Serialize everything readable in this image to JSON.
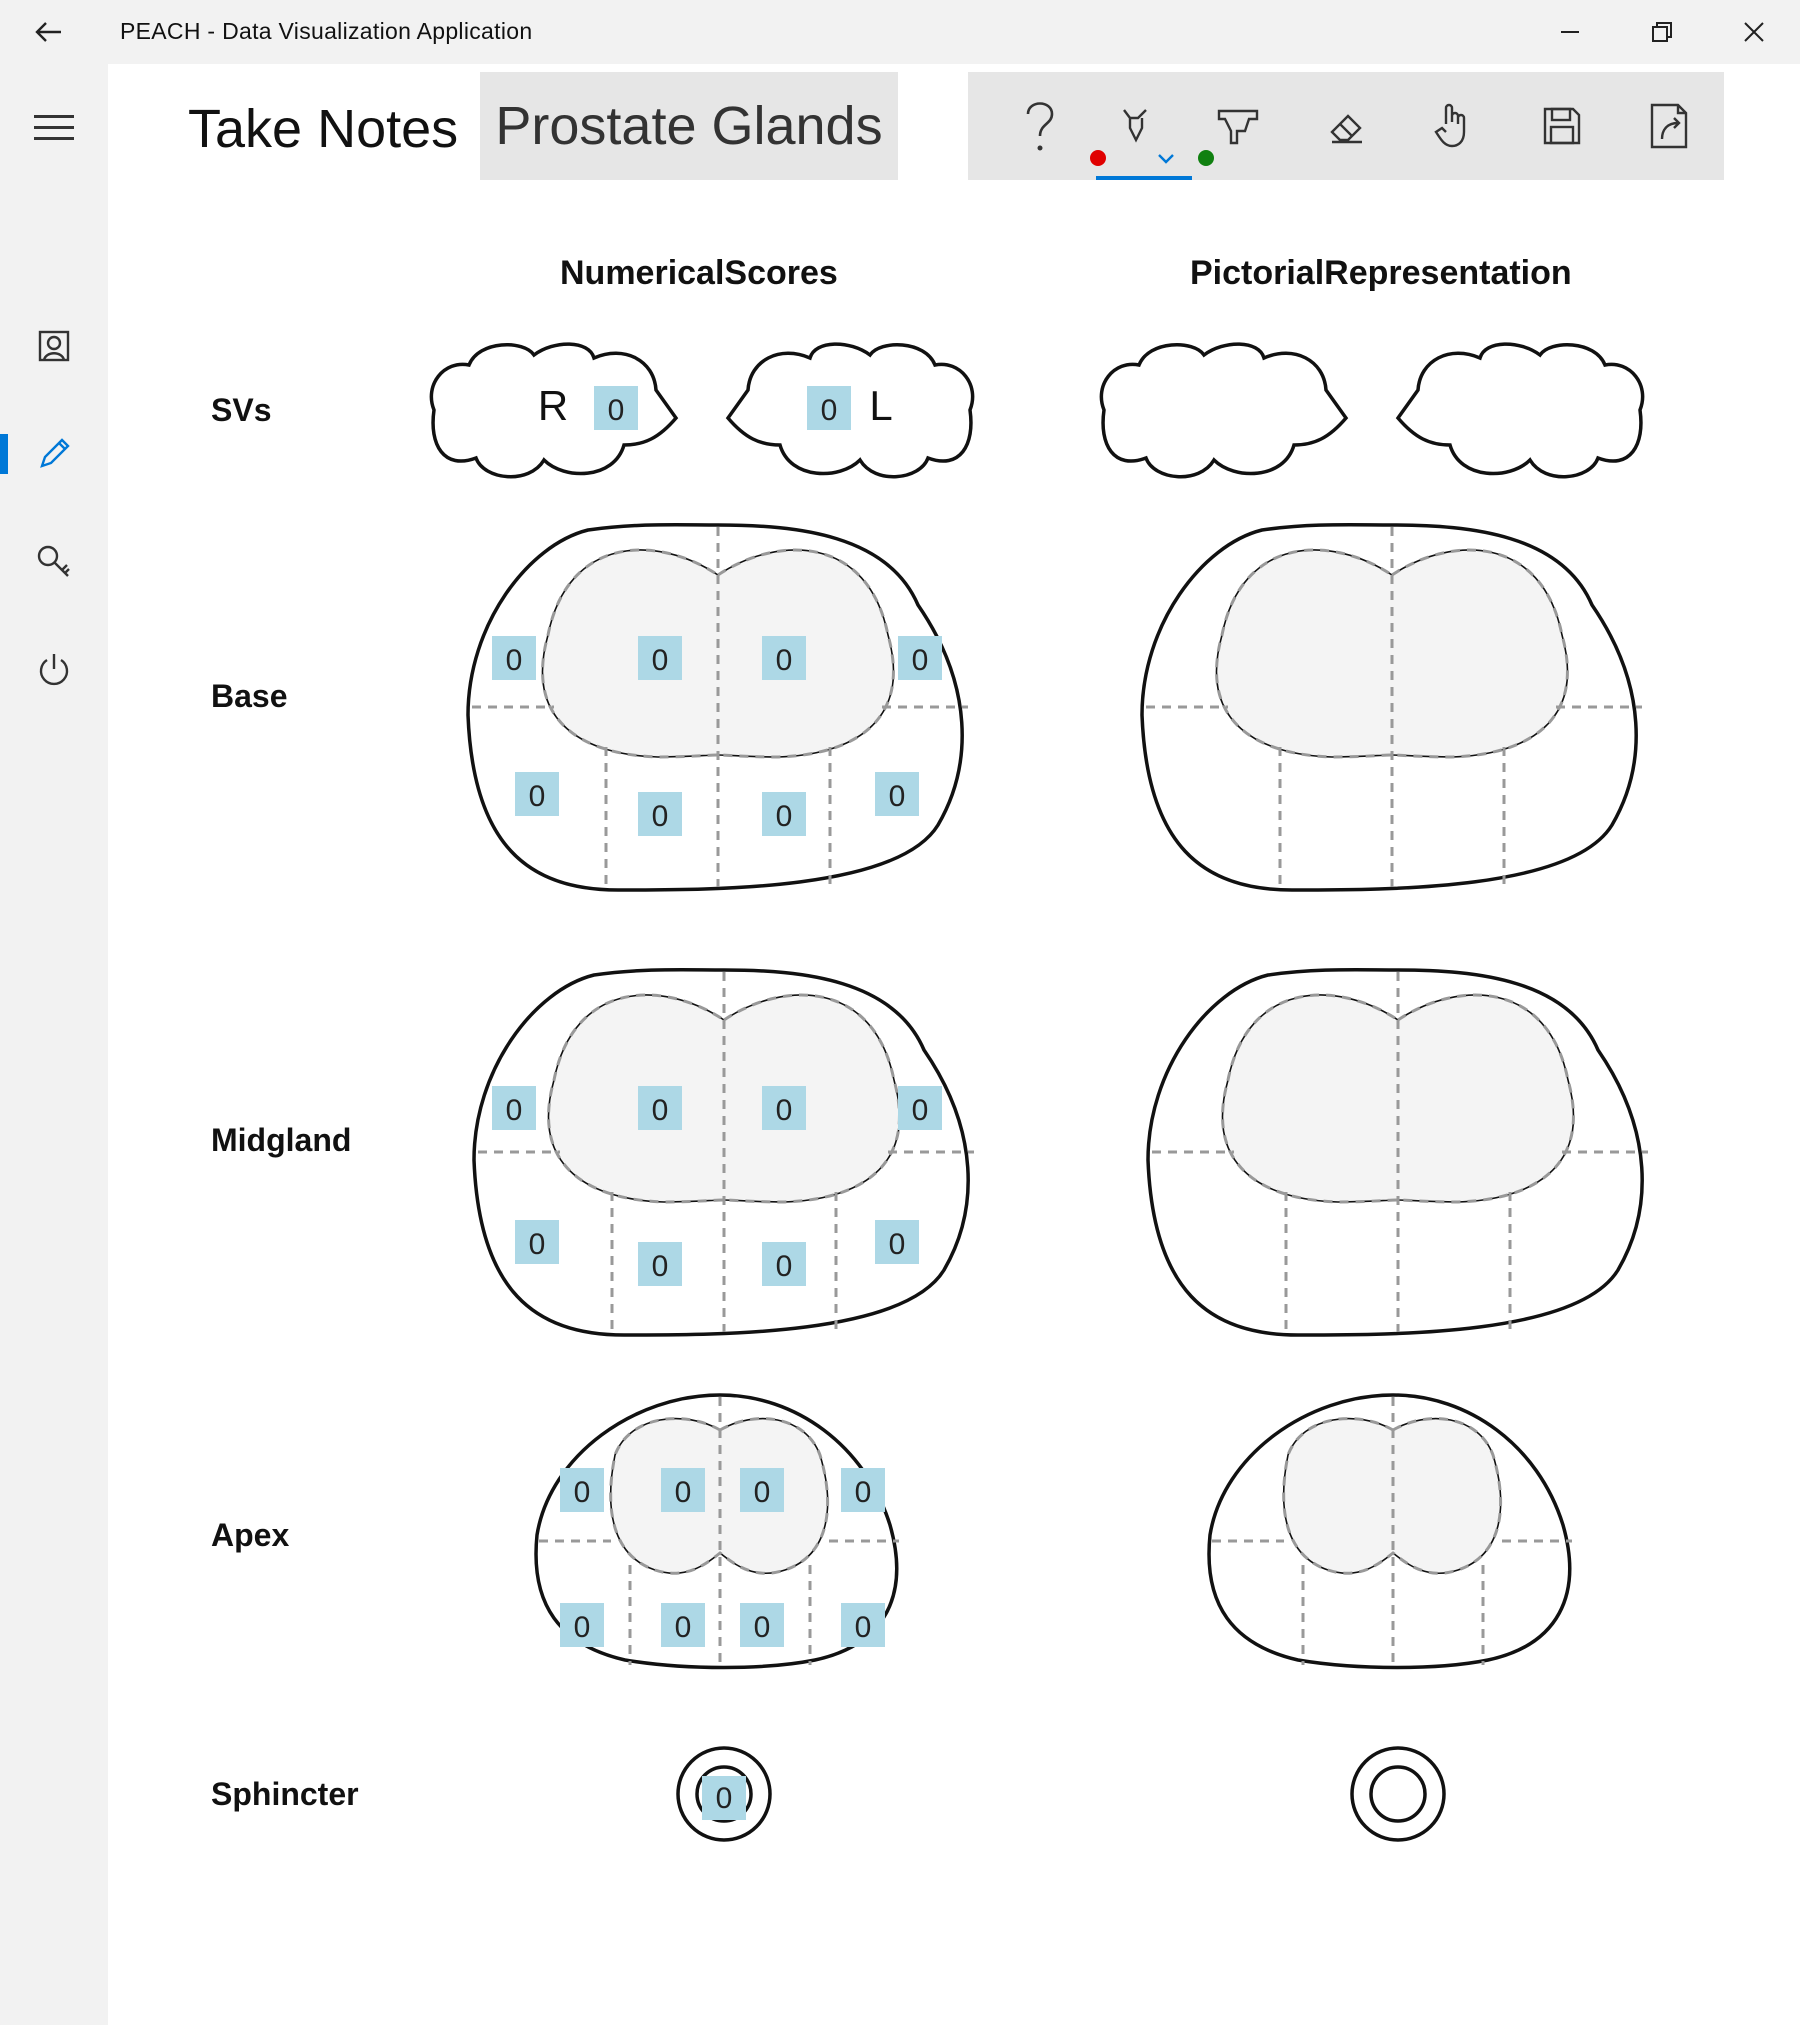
{
  "window": {
    "title": "PEACH - Data Visualization Application"
  },
  "window_controls": {
    "minimize": "minimize-icon",
    "restore": "restore-icon",
    "close": "close-icon"
  },
  "sidebar": {
    "items": [
      {
        "name": "menu",
        "icon": "hamburger-icon"
      },
      {
        "name": "profile",
        "icon": "profile-icon"
      },
      {
        "name": "notes",
        "icon": "pencil-icon",
        "active": true
      },
      {
        "name": "search",
        "icon": "search-key-icon"
      },
      {
        "name": "power",
        "icon": "power-icon"
      }
    ]
  },
  "header": {
    "title": "Take Notes",
    "tab": "Prostate Glands"
  },
  "toolbar": {
    "items": [
      {
        "name": "help",
        "icon": "question-icon"
      },
      {
        "name": "pen",
        "icon": "pen-icon",
        "color": "#e00000",
        "selected": true
      },
      {
        "name": "highlighter",
        "icon": "highlighter-icon",
        "color": "#108010"
      },
      {
        "name": "eraser",
        "icon": "eraser-icon"
      },
      {
        "name": "touch",
        "icon": "touch-icon"
      },
      {
        "name": "save",
        "icon": "save-icon"
      },
      {
        "name": "export",
        "icon": "export-icon"
      }
    ]
  },
  "columns": {
    "numerical": "NumericalScores",
    "pictorial": "PictorialRepresentation"
  },
  "rows": {
    "svs": "SVs",
    "base": "Base",
    "midgland": "Midgland",
    "apex": "Apex",
    "sphincter": "Sphincter"
  },
  "svs": {
    "right_label": "R",
    "left_label": "L",
    "right_score": "0",
    "left_score": "0"
  },
  "scores": {
    "base": [
      "0",
      "0",
      "0",
      "0",
      "0",
      "0",
      "0",
      "0"
    ],
    "midgland": [
      "0",
      "0",
      "0",
      "0",
      "0",
      "0",
      "0",
      "0"
    ],
    "apex": [
      "0",
      "0",
      "0",
      "0",
      "0",
      "0",
      "0",
      "0"
    ],
    "sphincter": "0"
  },
  "colors": {
    "score_box": "#add8e6",
    "accent": "#0078d7",
    "zone_fill": "#f4f4f4"
  }
}
